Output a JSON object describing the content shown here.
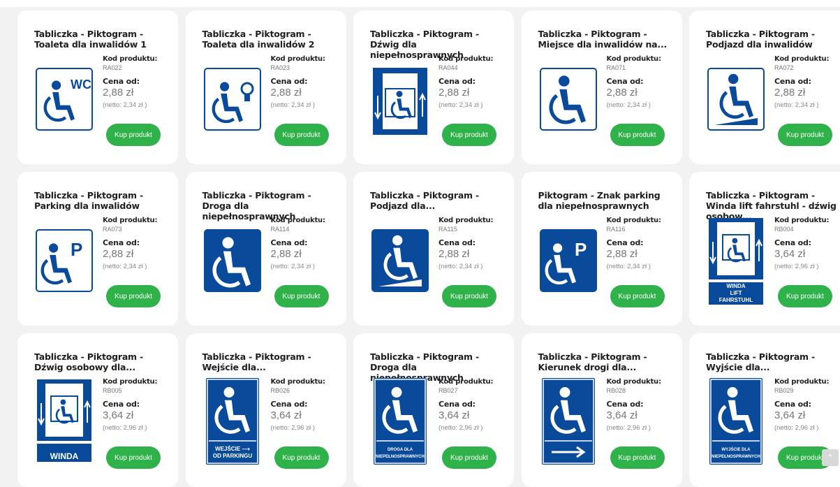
{
  "buy_label": "Kup produkt",
  "code_label": "Kod produktu:",
  "price_label": "Cena od:",
  "colors": {
    "sign_blue": "#0a4a9b",
    "button_green": "#2fb24a"
  },
  "products": [
    {
      "title": "Tabliczka - Piktogram - Toaleta dla inwalidów 1",
      "code": "RA022",
      "price": "2,88 zł",
      "netto": "(netto: 2,34 zł )",
      "icon": "wc-wheelchair-icon"
    },
    {
      "title": "Tabliczka - Piktogram - Toaleta dla inwalidów 2",
      "code": "RA023",
      "price": "2,88 zł",
      "netto": "(netto: 2,34 zł )",
      "icon": "toilet-wheelchair-icon"
    },
    {
      "title": "Tabliczka - Piktogram - Dźwig dla niepełnosprawnych",
      "code": "RA044",
      "price": "2,88 zł",
      "netto": "(netto: 2,34 zł )",
      "icon": "lift-icon"
    },
    {
      "title": "Tabliczka - Piktogram - Miejsce dla inwalidów na...",
      "code": "RA071",
      "price": "2,88 zł",
      "netto": "(netto: 2,34 zł )",
      "icon": "wheelchair-icon"
    },
    {
      "title": "Tabliczka - Piktogram - Podjazd dla inwalidów",
      "code": "RA072",
      "price": "2,88 zł",
      "netto": "(netto: 2,34 zł )",
      "icon": "ramp-icon"
    },
    {
      "title": "Tabliczka - Piktogram - Parking dla inwalidów",
      "code": "RA073",
      "price": "2,88 zł",
      "netto": "(netto: 2,34 zł )",
      "icon": "parking-wheelchair-icon"
    },
    {
      "title": "Tabliczka - Piktogram - Droga dla niepełnosprawnych",
      "code": "RA114",
      "price": "2,88 zł",
      "netto": "(netto: 2,34 zł )",
      "icon": "wheelchair-blue-icon"
    },
    {
      "title": "Tabliczka - Piktogram - Podjazd dla...",
      "code": "RA115",
      "price": "2,88 zł",
      "netto": "(netto: 2,34 zł )",
      "icon": "ramp-blue-icon"
    },
    {
      "title": "Piktogram - Znak parking dla niepełnosprawnych",
      "code": "RA116",
      "price": "2,88 zł",
      "netto": "(netto: 2,34 zł )",
      "icon": "parking-blue-icon"
    },
    {
      "title": "Tabliczka - Piktogram - Winda lift fahrstuhl - dźwig osobow...",
      "code": "RB004",
      "price": "3,64 zł",
      "netto": "(netto: 2,96 zł )",
      "icon": "lift-caption-icon",
      "sign_text": [
        "WINDA",
        "LIFT",
        "FAHRSTUHL"
      ]
    },
    {
      "title": "Tabliczka - Piktogram - Dźwig osobowy dla...",
      "code": "RB005",
      "price": "3,64 zł",
      "netto": "(netto: 2,96 zł )",
      "icon": "lift-caption-icon",
      "sign_text": [
        "WINDA"
      ]
    },
    {
      "title": "Tabliczka - Piktogram - Wejście dla...",
      "code": "RB026",
      "price": "3,64 zł",
      "netto": "(netto: 2,96 zł )",
      "icon": "entrance-sign-icon",
      "sign_text": [
        "WEJŚCIE ⟶",
        "OD PARKINGU"
      ]
    },
    {
      "title": "Tabliczka - Piktogram - Droga dla niepełnosprawnych",
      "code": "RB027",
      "price": "3,64 zł",
      "netto": "(netto: 2,96 zł )",
      "icon": "road-sign-icon",
      "sign_text": [
        "DROGA DLA",
        "NIEPEŁNOSPRAWNYCH"
      ]
    },
    {
      "title": "Tabliczka - Piktogram - Kierunek drogi dla...",
      "code": "RB028",
      "price": "3,64 zł",
      "netto": "(netto: 2,96 zł )",
      "icon": "direction-sign-icon",
      "sign_text": []
    },
    {
      "title": "Tabliczka - Piktogram - Wyjście dla...",
      "code": "RB029",
      "price": "3,64 zł",
      "netto": "(netto: 2,96 zł )",
      "icon": "exit-sign-icon",
      "sign_text": [
        "WYJŚCIE DLA",
        "NIEPEŁNOSPRAWNYCH"
      ]
    }
  ],
  "scroll_top_glyph": "⌃"
}
